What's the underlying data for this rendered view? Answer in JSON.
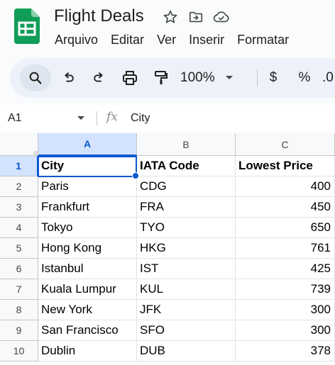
{
  "doc": {
    "title": "Flight Deals",
    "star_icon": "star-icon",
    "move_icon": "move-to-folder-icon",
    "cloud_icon": "cloud-saved-icon"
  },
  "menu": [
    "Arquivo",
    "Editar",
    "Ver",
    "Inserir",
    "Formatar"
  ],
  "toolbar": {
    "zoom": "100%",
    "currency": "$",
    "percent": "%",
    "decimal": ".0"
  },
  "formula_bar": {
    "cell_ref": "A1",
    "fx": "fx",
    "content": "City"
  },
  "grid": {
    "columns": [
      "A",
      "B",
      "C"
    ],
    "row_numbers": [
      "1",
      "2",
      "3",
      "4",
      "5",
      "6",
      "7",
      "8",
      "9",
      "10"
    ],
    "rows": [
      [
        "City",
        "IATA Code",
        "Lowest Price"
      ],
      [
        "Paris",
        "CDG",
        "400"
      ],
      [
        "Frankfurt",
        "FRA",
        "450"
      ],
      [
        "Tokyo",
        "TYO",
        "650"
      ],
      [
        "Hong Kong",
        "HKG",
        "761"
      ],
      [
        "Istanbul",
        "IST",
        "425"
      ],
      [
        "Kuala Lumpur",
        "KUL",
        "739"
      ],
      [
        "New York",
        "JFK",
        "300"
      ],
      [
        "San Francisco",
        "SFO",
        "300"
      ],
      [
        "Dublin",
        "DUB",
        "378"
      ]
    ]
  },
  "colors": {
    "accent": "#0b57d0",
    "sheets_green": "#0f9d58",
    "toolbar_bg": "#edf2fa"
  }
}
